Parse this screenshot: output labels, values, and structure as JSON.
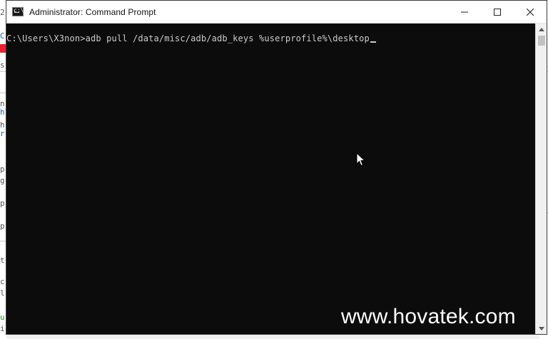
{
  "window": {
    "title": "Administrator: Command Prompt",
    "icon": "command-prompt-icon"
  },
  "caption_buttons": {
    "minimize": "minimize-icon",
    "maximize": "maximize-icon",
    "close": "close-icon"
  },
  "console": {
    "prompt": "C:\\Users\\X3non>",
    "command": "adb pull /data/misc/adb/adb_keys %userprofile%\\desktop"
  },
  "background_window": {
    "left_fragments": [
      "2[",
      "C:",
      "s",
      "n",
      "h",
      "h",
      "r",
      "p",
      "g",
      "p",
      "p",
      "t",
      "c",
      "l",
      "u",
      "i"
    ],
    "right_fragments": [
      "r"
    ]
  },
  "watermark": "www.hovatek.com",
  "colors": {
    "console_bg": "#0c0c0c",
    "console_text": "#cccccc",
    "titlebar_bg": "#ffffff"
  }
}
